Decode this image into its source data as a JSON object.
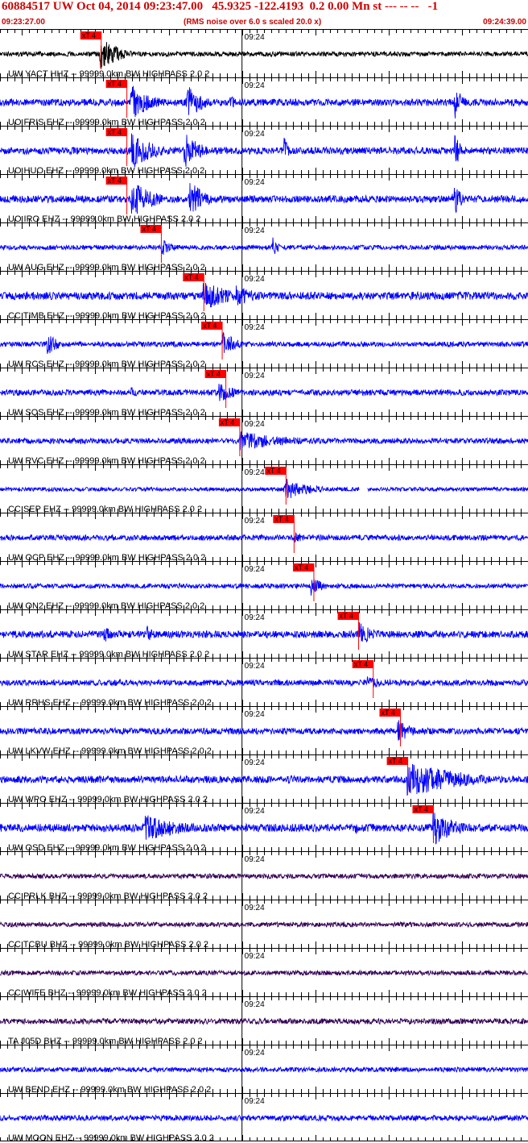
{
  "header": {
    "title": "60884517 UW Oct 04, 2014 09:23:47.00   45.9325 -122.4193  0.2 0.00 Mn st --- -- --   -1",
    "start_time": "09:23:27.00",
    "noise_note": "(RMS noise over 6.0 s scaled 20.0 x)",
    "end_time": "09:24:39.00"
  },
  "chart_data": {
    "type": "line",
    "title": "60884517 UW Oct 04, 2014 09:23:47.00   45.9325 -122.4193  0.2 0.00 Mn st --- -- --   -1",
    "x_range": [
      "09:23:27.00",
      "09:24:39.00"
    ],
    "x_seconds_span": 72,
    "minute_mark_label": "09:24",
    "pick_label": "xT 4",
    "colors": {
      "red": "#ff0000",
      "blue": "#0000ff",
      "black": "#000000",
      "purple": "#330055"
    },
    "traces": [
      {
        "label": "UW YACT HHZ -- 99999.0km BW  HIGHPASS  2.0  2",
        "color": "#000000",
        "pick_s": 13.8,
        "noise": 0.12,
        "events": [
          {
            "t": 13.6,
            "a": 0.9,
            "d": 2.5
          }
        ]
      },
      {
        "label": "UO FRIS EHZ -- 99999.0km BW  HIGHPASS  2.0  2",
        "color": "#0000ff",
        "pick_s": 17.3,
        "noise": 0.18,
        "events": [
          {
            "t": 17.8,
            "a": 1.0,
            "d": 2.6
          },
          {
            "t": 25.5,
            "a": 1.0,
            "d": 2.1
          },
          {
            "t": 31.2,
            "a": 0.6,
            "d": 0.8
          },
          {
            "t": 62.0,
            "a": 1.0,
            "d": 1.0
          }
        ]
      },
      {
        "label": "UO HUO EHZ -- 99999.0km BW  HIGHPASS  2.0  2",
        "color": "#0000ff",
        "pick_s": 17.3,
        "noise": 0.18,
        "events": [
          {
            "t": 17.9,
            "a": 1.0,
            "d": 3.0
          },
          {
            "t": 25.1,
            "a": 1.0,
            "d": 2.2
          },
          {
            "t": 38.7,
            "a": 0.8,
            "d": 0.6
          },
          {
            "t": 62.0,
            "a": 1.0,
            "d": 0.8
          }
        ]
      },
      {
        "label": "UO IRO EHZ -- 99999.0km BW  HIGHPASS  2.0  2",
        "color": "#0000ff",
        "pick_s": 17.3,
        "noise": 0.18,
        "events": [
          {
            "t": 17.9,
            "a": 1.0,
            "d": 3.0
          },
          {
            "t": 25.8,
            "a": 1.0,
            "d": 2.2
          },
          {
            "t": 61.8,
            "a": 1.0,
            "d": 1.0
          }
        ]
      },
      {
        "label": "UW AUG EHZ -- 99999.0km BW  HIGHPASS  2.0  2",
        "color": "#0000ff",
        "pick_s": 22.0,
        "noise": 0.12,
        "events": [
          {
            "t": 22.0,
            "a": 0.5,
            "d": 1.6
          },
          {
            "t": 37.2,
            "a": 0.7,
            "d": 0.6
          }
        ]
      },
      {
        "label": "CC TIMB EHZ -- 99999.0km BW  HIGHPASS  2.0  2",
        "color": "#0000ff",
        "pick_s": 27.8,
        "noise": 0.2,
        "events": [
          {
            "t": 27.5,
            "a": 0.8,
            "d": 4.0
          },
          {
            "t": 32.0,
            "a": 0.6,
            "d": 3.0
          }
        ]
      },
      {
        "label": "UW RCS EHZ -- 99999.0km BW  HIGHPASS  2.0  2",
        "color": "#0000ff",
        "pick_s": 30.3,
        "noise": 0.13,
        "events": [
          {
            "t": 6.4,
            "a": 0.6,
            "d": 1.8
          },
          {
            "t": 30.3,
            "a": 0.7,
            "d": 2.0
          }
        ]
      },
      {
        "label": "UW SQS EHZ -- 99999.0km BW  HIGHPASS  2.0  2",
        "color": "#0000ff",
        "pick_s": 30.8,
        "noise": 0.15,
        "events": [
          {
            "t": 17.8,
            "a": 0.3,
            "d": 2.6
          },
          {
            "t": 29.8,
            "a": 0.55,
            "d": 2.4
          }
        ]
      },
      {
        "label": "UW RVC EHZ -- 99999.0km BW  HIGHPASS  2.0  2",
        "color": "#0000ff",
        "pick_s": 32.7,
        "noise": 0.14,
        "events": [
          {
            "t": 32.7,
            "a": 0.5,
            "d": 8.0
          }
        ]
      },
      {
        "label": "CC SEP EHZ -- 99999.0km BW  HIGHPASS  2.0  2",
        "color": "#0000ff",
        "pick_s": 39.0,
        "noise": 0.1,
        "gap": [
          49.0,
          50.1
        ],
        "events": [
          {
            "t": 38.8,
            "a": 0.6,
            "d": 3.5
          }
        ]
      },
      {
        "label": "UW OCP EHZ -- 99999.0km BW  HIGHPASS  2.0  2",
        "color": "#0000ff",
        "pick_s": 40.1,
        "noise": 0.14,
        "events": [
          {
            "t": 40.1,
            "a": 0.3,
            "d": 2.0
          }
        ]
      },
      {
        "label": "UW ON2 EHZ -- 99999.0km BW  HIGHPASS  2.0  2",
        "color": "#0000ff",
        "pick_s": 42.8,
        "noise": 0.12,
        "events": [
          {
            "t": 42.4,
            "a": 0.5,
            "d": 1.8
          }
        ]
      },
      {
        "label": "UW STAR EHZ -- 99999.0km BW  HIGHPASS  2.0  2",
        "color": "#0000ff",
        "pick_s": 48.9,
        "noise": 0.18,
        "events": [
          {
            "t": 14.2,
            "a": 0.5,
            "d": 1.4
          },
          {
            "t": 20.0,
            "a": 0.5,
            "d": 1.2
          },
          {
            "t": 48.9,
            "a": 0.7,
            "d": 2.2
          }
        ]
      },
      {
        "label": "UW RRHS EHZ -- 99999.0km BW  HIGHPASS  2.0  2",
        "color": "#0000ff",
        "pick_s": 50.9,
        "noise": 0.15,
        "events": [
          {
            "t": 50.1,
            "a": 0.35,
            "d": 3.0
          }
        ]
      },
      {
        "label": "UW LKVW EHZ -- 99999.0km BW  HIGHPASS  2.0  2",
        "color": "#0000ff",
        "pick_s": 54.6,
        "noise": 0.16,
        "events": [
          {
            "t": 54.2,
            "a": 0.65,
            "d": 2.0
          }
        ]
      },
      {
        "label": "UW WPO EHZ -- 99999.0km BW  HIGHPASS  2.0  2",
        "color": "#0000ff",
        "pick_s": 55.6,
        "noise": 0.18,
        "events": [
          {
            "t": 55.5,
            "a": 1.0,
            "d": 7.5
          }
        ]
      },
      {
        "label": "UW OSD EHZ -- 99999.0km BW  HIGHPASS  2.0  2",
        "color": "#0000ff",
        "pick_s": 59.1,
        "noise": 0.2,
        "events": [
          {
            "t": 19.8,
            "a": 0.7,
            "d": 5.5
          },
          {
            "t": 48.4,
            "a": 0.4,
            "d": 1.0
          },
          {
            "t": 59.0,
            "a": 1.0,
            "d": 3.0
          }
        ]
      },
      {
        "label": "CC PRLK BHZ -- 99999.0km BW  HIGHPASS  2.0  2",
        "color": "#330055",
        "pick_s": null,
        "noise": 0.12,
        "events": []
      },
      {
        "label": "CC TCBU BHZ -- 99999.0km BW  HIGHPASS  2.0  2",
        "color": "#330055",
        "pick_s": null,
        "noise": 0.12,
        "events": []
      },
      {
        "label": "CC WIFE BHZ -- 99999.0km BW  HIGHPASS  2.0  2",
        "color": "#330055",
        "pick_s": null,
        "noise": 0.12,
        "events": []
      },
      {
        "label": "TA J05D BHZ -- 99999.0km BW  HIGHPASS  2.0  2",
        "color": "#330055",
        "pick_s": null,
        "noise": 0.14,
        "events": []
      },
      {
        "label": "UW BEND EHZ -- 99999.0km BW  HIGHPASS  2.0  2",
        "color": "#0000ff",
        "pick_s": null,
        "noise": 0.12,
        "events": []
      },
      {
        "label": "UW MOON EHZ -- 99999.0km BW  HIGHPASS  2.0  2",
        "color": "#0000ff",
        "pick_s": null,
        "noise": 0.14,
        "events": []
      }
    ]
  }
}
